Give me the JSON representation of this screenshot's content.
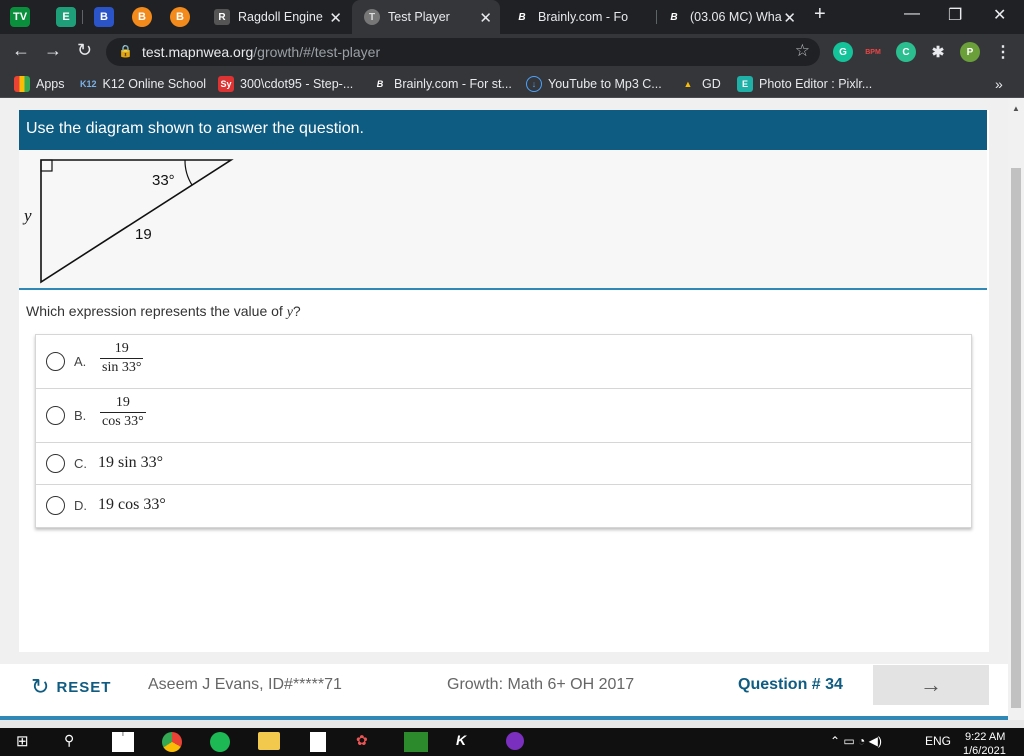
{
  "browser": {
    "pinned": [
      "TV",
      "E",
      "B",
      "B",
      "B"
    ],
    "tabs": [
      {
        "title": "Ragdoll Engine",
        "favicon": "R"
      },
      {
        "title": "Test Player",
        "favicon": "T"
      },
      {
        "title": "Brainly.com - Fo",
        "favicon": "B"
      },
      {
        "title": "(03.06 MC) Wha",
        "favicon": "B"
      }
    ],
    "url_host": "test.mapnwea.org",
    "url_path": "/growth/#/test-player",
    "bookmarks": [
      {
        "label": "Apps",
        "icon": "K12"
      },
      {
        "label": "K12 Online School",
        "icon": "K12"
      },
      {
        "label": "300\\cdot95 - Step-...",
        "icon": "Sy"
      },
      {
        "label": "Brainly.com - For st...",
        "icon": "B"
      },
      {
        "label": "YouTube to Mp3 C...",
        "icon": "Y"
      },
      {
        "label": "GD",
        "icon": "G"
      },
      {
        "label": "Photo Editor : Pixlr...",
        "icon": "E"
      }
    ],
    "extensions": [
      "G",
      "BPM",
      "C",
      "P"
    ]
  },
  "question": {
    "header": "Use the diagram shown to answer the question.",
    "diagram": {
      "angle_label": "33°",
      "side_label": "19",
      "var_label": "y"
    },
    "prompt": "Which expression represents the value of ",
    "prompt_var": "y",
    "prompt_end": "?",
    "choices": [
      {
        "letter": "A.",
        "numerator": "19",
        "denominator": "sin 33°"
      },
      {
        "letter": "B.",
        "numerator": "19",
        "denominator": "cos 33°"
      },
      {
        "letter": "C.",
        "expression": "19 sin 33°"
      },
      {
        "letter": "D.",
        "expression": "19 cos 33°"
      }
    ]
  },
  "footer": {
    "reset_label": "RESET",
    "student": "Aseem J Evans, ID#*****71",
    "test_name": "Growth: Math 6+ OH 2017",
    "question_number": "Question # 34",
    "next_arrow": "→"
  },
  "taskbar": {
    "lang": "ENG",
    "time": "9:22 AM",
    "date": "1/6/2021"
  },
  "colors": {
    "header_blue": "#0f5c82",
    "accent_blue": "#2f88b6"
  }
}
